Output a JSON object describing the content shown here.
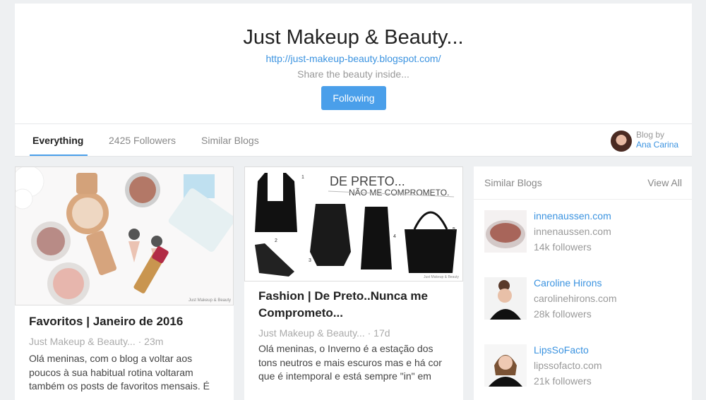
{
  "header": {
    "title": "Just Makeup & Beauty...",
    "url": "http://just-makeup-beauty.blogspot.com/",
    "tagline": "Share the beauty inside...",
    "follow_label": "Following"
  },
  "tabs": [
    {
      "label": "Everything",
      "active": true
    },
    {
      "label": "2425 Followers",
      "active": false
    },
    {
      "label": "Similar Blogs",
      "active": false
    }
  ],
  "author": {
    "by_label": "Blog by",
    "name": "Ana Carina"
  },
  "posts": [
    {
      "title": "Favoritos | Janeiro de 2016",
      "source": "Just Makeup & Beauty...",
      "age": "23m",
      "excerpt": "Olá meninas, com o blog a voltar aos poucos à sua habitual rotina voltaram também os posts de favoritos mensais. É",
      "image_watermark": "Just Makeup & Beauty"
    },
    {
      "title": "Fashion | De Preto..Nunca me Comprometo...",
      "source": "Just Makeup & Beauty...",
      "age": "17d",
      "excerpt": "Olá meninas, o Inverno é a estação dos tons neutros e mais escuros mas e há cor que é intemporal e está sempre \"in\" em",
      "image_heading": "DE PRETO...",
      "image_subheading": "NÃO ME COMPROMETO.",
      "image_watermark": "Just Makeup & Beauty",
      "item_numbers": [
        "1",
        "2",
        "3",
        "4",
        "5"
      ]
    }
  ],
  "sidebar": {
    "heading": "Similar Blogs",
    "view_all": "View All",
    "blogs": [
      {
        "name": "innenaussen.com",
        "domain": "innenaussen.com",
        "followers": "14k followers"
      },
      {
        "name": "Caroline Hirons",
        "domain": "carolinehirons.com",
        "followers": "28k followers"
      },
      {
        "name": "LipsSoFacto",
        "domain": "lipssofacto.com",
        "followers": "21k followers"
      }
    ]
  },
  "colors": {
    "accent": "#4a9fea",
    "link": "#3b93e0",
    "page_background": "#eef0f2"
  }
}
